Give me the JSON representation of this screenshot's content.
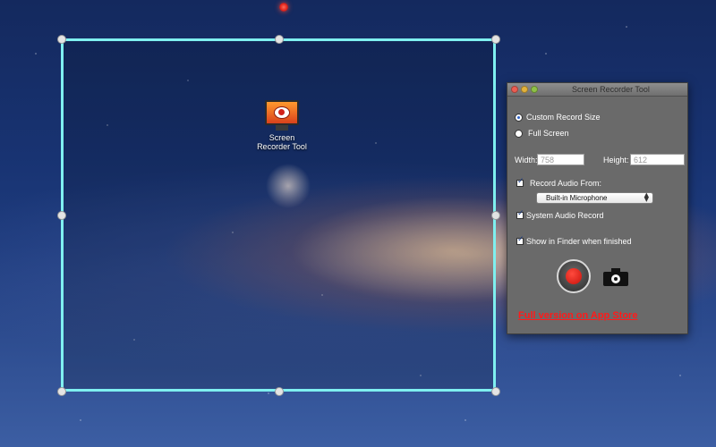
{
  "desktop": {
    "icon_label_line1": "Screen",
    "icon_label_line2": "Recorder Tool"
  },
  "window": {
    "title": "Screen Recorder Tool",
    "options": {
      "custom_record_size": "Custom Record Size",
      "full_screen": "Full Screen",
      "selected": "custom_record_size"
    },
    "width_label": "Width:",
    "width_value": "758",
    "height_label": "Height:",
    "height_value": "612",
    "record_audio_label": "Record Audio From:",
    "record_audio_checked": true,
    "audio_source": "Built-in Microphone",
    "system_audio_label": "System Audio Record",
    "system_audio_checked": true,
    "show_in_finder_label": "Show in Finder when finished",
    "show_in_finder_checked": true,
    "full_version_link": "Full version on App Store"
  },
  "colors": {
    "selection_border": "#7ff0f0",
    "link": "#ff1a1a",
    "record_button": "#c8120b",
    "window_bg": "#6a6a6a"
  }
}
